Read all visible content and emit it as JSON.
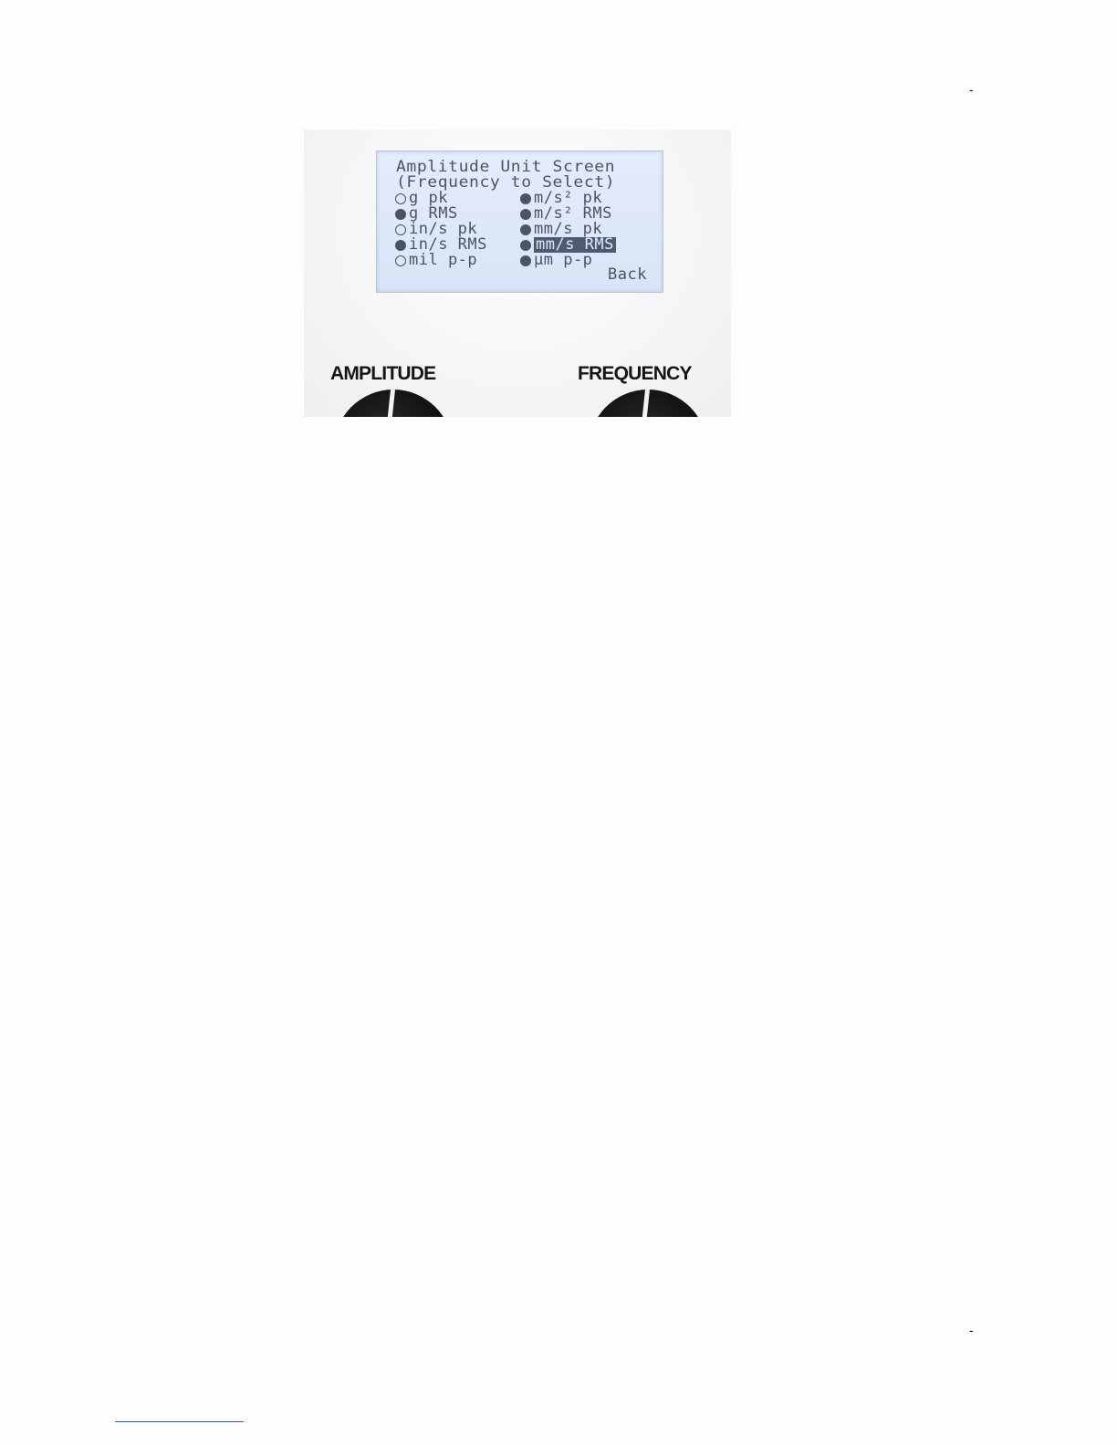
{
  "page_marks": {
    "top": "-",
    "bottom": "-"
  },
  "lcd": {
    "title": "Amplitude Unit Screen",
    "subtitle": "(Frequency to Select)",
    "options_left": [
      {
        "label": "g pk",
        "selected": false
      },
      {
        "label": "g RMS",
        "selected": true
      },
      {
        "label": "in/s pk",
        "selected": false
      },
      {
        "label": "in/s RMS",
        "selected": true
      },
      {
        "label": "mil p-p",
        "selected": false
      }
    ],
    "options_right": [
      {
        "label": "m/s² pk",
        "selected": true
      },
      {
        "label": "m/s² RMS",
        "selected": true
      },
      {
        "label": "mm/s pk",
        "selected": true
      },
      {
        "label": "mm/s RMS",
        "selected": true,
        "highlighted": true
      },
      {
        "label": "µm p-p",
        "selected": true
      }
    ],
    "back_label": "Back"
  },
  "knobs": {
    "amplitude_label": "AMPLITUDE",
    "frequency_label": "FREQUENCY"
  }
}
